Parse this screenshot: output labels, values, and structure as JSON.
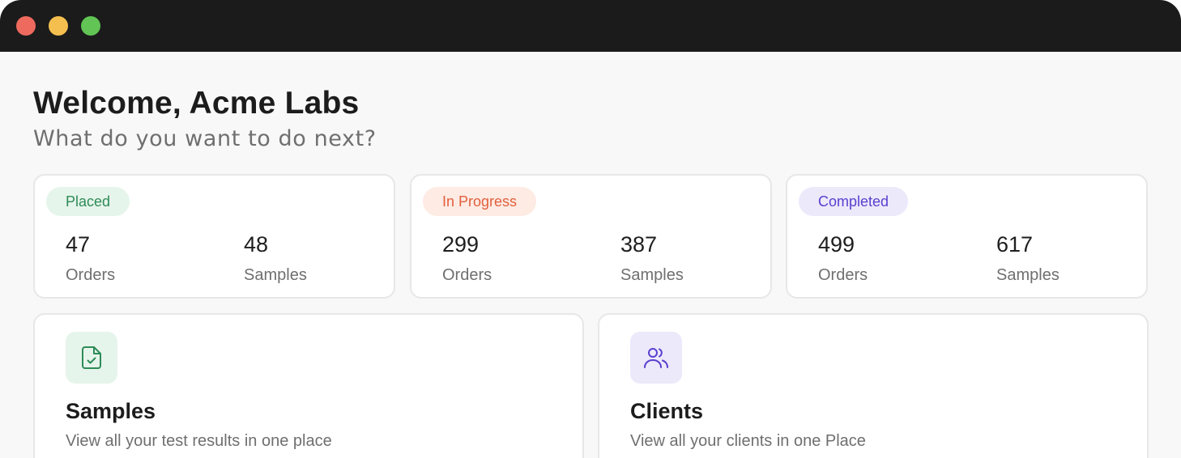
{
  "header": {
    "welcome": "Welcome, Acme Labs",
    "subtitle": "What do you want to do next?"
  },
  "stats": [
    {
      "status": "Placed",
      "orders": "47",
      "samples": "48",
      "orders_label": "Orders",
      "samples_label": "Samples",
      "color": "#2e8b57"
    },
    {
      "status": "In Progress",
      "orders": "299",
      "samples": "387",
      "orders_label": "Orders",
      "samples_label": "Samples",
      "color": "#e2603d"
    },
    {
      "status": "Completed",
      "orders": "499",
      "samples": "617",
      "orders_label": "Orders",
      "samples_label": "Samples",
      "color": "#5a3fcf"
    }
  ],
  "cards": [
    {
      "title": "Samples",
      "description": "View all your test results in one place",
      "icon": "document-check-icon"
    },
    {
      "title": "Clients",
      "description": "View all your clients in one Place",
      "icon": "users-icon"
    }
  ]
}
